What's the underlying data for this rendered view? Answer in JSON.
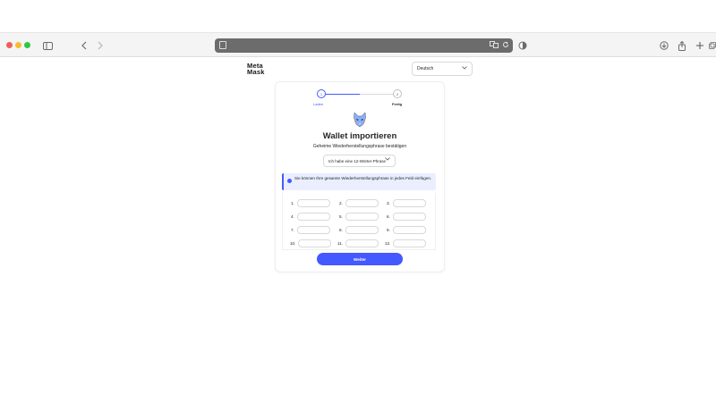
{
  "logo": {
    "line1": "Meta",
    "line2": "Mask"
  },
  "language_select": {
    "value": "Deutsch"
  },
  "stepper": {
    "steps": [
      {
        "number": "1",
        "label": "Laden"
      },
      {
        "number": "2",
        "label": "Fertig"
      }
    ]
  },
  "main": {
    "title": "Wallet importieren",
    "subtitle": "Geheime Wiederherstellungsphrase bestätigen",
    "phrase_length_select": "Ich habe eine 12-Wörter-Phrase",
    "info_text": "Sie können Ihre gesamte Wiederherstellungsphrase in jedes Feld einfügen.",
    "word_fields": [
      {
        "number": "1."
      },
      {
        "number": "2."
      },
      {
        "number": "3."
      },
      {
        "number": "4."
      },
      {
        "number": "5."
      },
      {
        "number": "6."
      },
      {
        "number": "7."
      },
      {
        "number": "8."
      },
      {
        "number": "9."
      },
      {
        "number": "10."
      },
      {
        "number": "11."
      },
      {
        "number": "12."
      }
    ],
    "continue_button": "Weiter"
  },
  "colors": {
    "accent": "#4459ff",
    "info_background": "#eaeeff"
  }
}
